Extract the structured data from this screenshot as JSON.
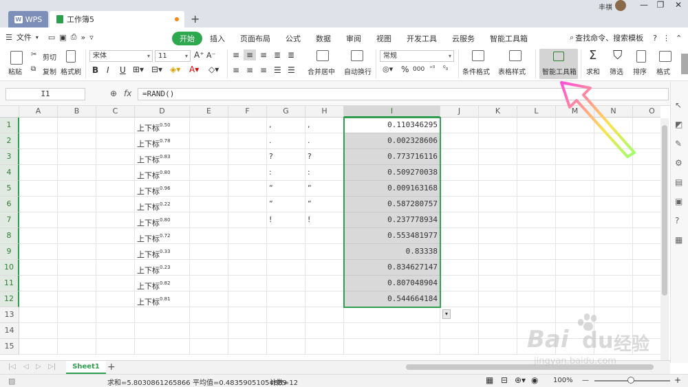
{
  "titlebar": {
    "app_tab": "WPS",
    "doc_tab": "工作簿5",
    "add_tab": "+",
    "user_name": "丰祺",
    "win_controls": [
      "—",
      "❐",
      "✕"
    ]
  },
  "menu": {
    "file_label": "文件",
    "tabs": [
      "开始",
      "插入",
      "页面布局",
      "公式",
      "数据",
      "审阅",
      "视图",
      "开发工具",
      "云服务",
      "智能工具箱"
    ],
    "search_label": "查找命令、搜索模板",
    "help": "?",
    "more": "⋮"
  },
  "ribbon": {
    "paste": "粘贴",
    "cut": "剪切",
    "copy": "复制",
    "format_painter": "格式刷",
    "font_name": "宋体",
    "font_size": "11",
    "bold": "B",
    "italic": "I",
    "underline": "U",
    "merge_center": "合并居中",
    "wrap_text": "自动换行",
    "number_format": "常规",
    "percent": "%",
    "comma": "000",
    "conditional_format": "条件格式",
    "table_style": "表格样式",
    "smart_toolbox": "智能工具箱",
    "sum": "求和",
    "filter": "筛选",
    "sort": "排序",
    "format": "格式"
  },
  "formula_bar": {
    "name_box": "I1",
    "formula": "=RAND()"
  },
  "columns": [
    "A",
    "B",
    "C",
    "D",
    "E",
    "F",
    "G",
    "H",
    "I",
    "J",
    "K",
    "L",
    "M",
    "N",
    "O"
  ],
  "rows": [
    "1",
    "2",
    "3",
    "4",
    "5",
    "6",
    "7",
    "8",
    "9",
    "10",
    "11",
    "12",
    "13",
    "14",
    "15"
  ],
  "col_d_text": "上下标",
  "col_d_sup": [
    "0.50",
    "0.78",
    "0.83",
    "0.80",
    "0.96",
    "0.22",
    "0.80",
    "0.72",
    "0.33",
    "0.23",
    "0.82",
    "0.81"
  ],
  "col_g": [
    ",",
    ".",
    "?",
    ":",
    "“",
    "”",
    "!"
  ],
  "col_h": [
    ",",
    ".",
    "?",
    ":",
    "“",
    "”",
    "!"
  ],
  "col_i": [
    "0.110346295",
    "0.002328606",
    "0.773716116",
    "0.509270038",
    "0.009163168",
    "0.587280757",
    "0.237778934",
    "0.553481977",
    "0.83338",
    "0.834627147",
    "0.807048904",
    "0.544664184"
  ],
  "sheet": {
    "active_tab": "Sheet1",
    "add": "+"
  },
  "status": {
    "sum": "求和=5.8030861265866",
    "average": "平均值=0.48359051054889",
    "count": "计数=12",
    "zoom": "100%",
    "zoom_minus": "—",
    "zoom_plus": "+"
  },
  "watermark": {
    "brand": "Bai",
    "brand2": "du",
    "cn": "经验",
    "url": "jingyan.baidu.com"
  },
  "colors": {
    "accent": "#2ea84f",
    "selection": "#d9d9d9",
    "arrow_gradient": [
      "#ff4fd8",
      "#ffe14f",
      "#9dff6b"
    ]
  }
}
